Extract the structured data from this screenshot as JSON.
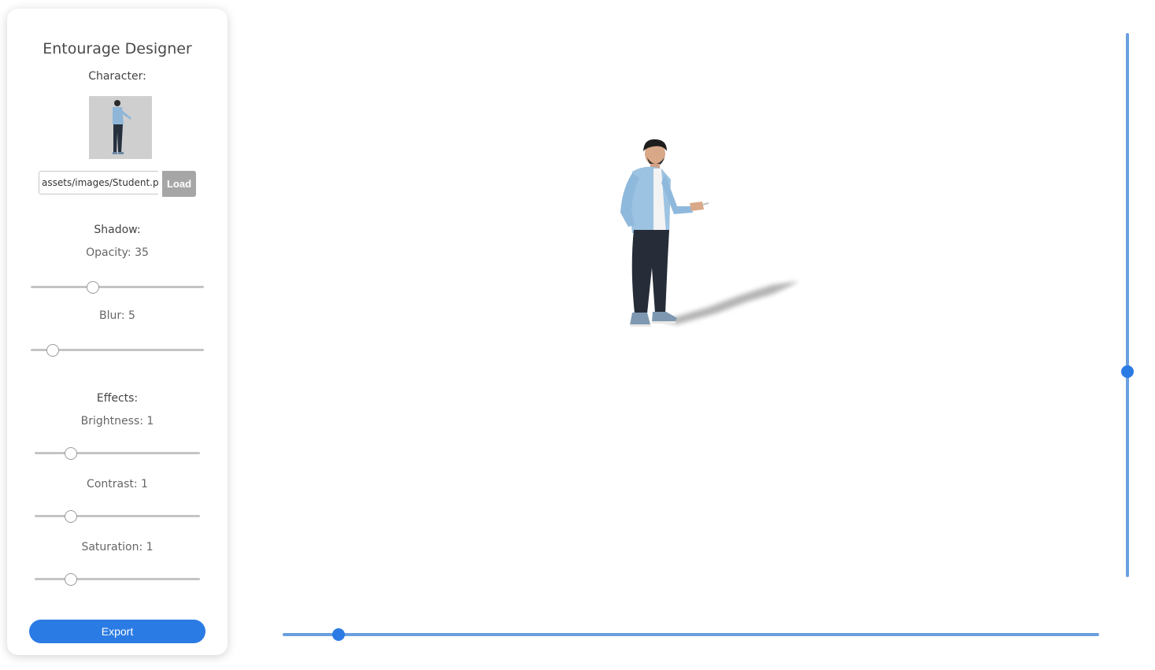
{
  "panel": {
    "title": "Entourage Designer",
    "character": {
      "heading": "Character:",
      "thumbnail_icon": "standing-man-figure",
      "path_value": "assets/images/Student.png",
      "load_label": "Load"
    },
    "shadow": {
      "heading": "Shadow:",
      "opacity_label": "Opacity: 35",
      "opacity_value": 35,
      "blur_label": "Blur: 5",
      "blur_value": 5
    },
    "effects": {
      "heading": "Effects:",
      "brightness_label": "Brightness: 1",
      "brightness_value": 1,
      "contrast_label": "Contrast: 1",
      "contrast_value": 1,
      "saturation_label": "Saturation: 1",
      "saturation_value": 1
    },
    "export_label": "Export"
  },
  "canvas": {
    "figure_icon": "standing-man-with-shadow",
    "horizontal_slider_fraction": 0.07,
    "vertical_slider_fraction": 0.62
  },
  "colors": {
    "accent": "#2b7be4",
    "track": "#6a9fe0",
    "load_button": "#a6a6a6"
  }
}
